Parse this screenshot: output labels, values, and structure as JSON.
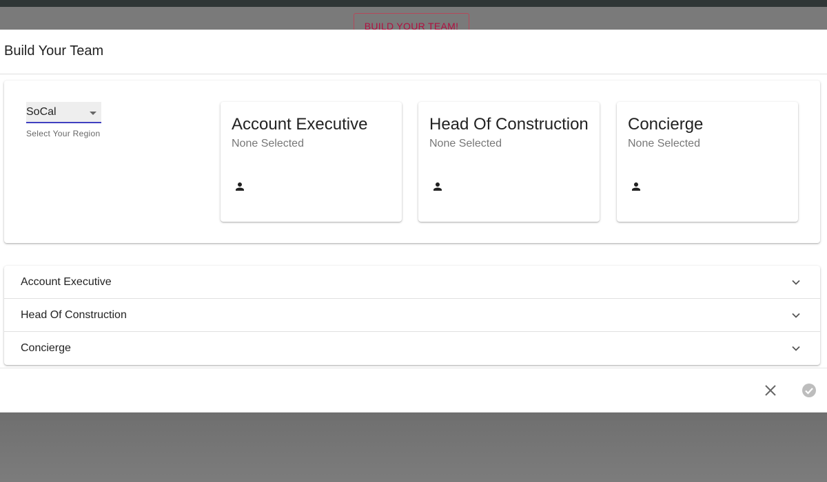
{
  "background": {
    "cta_label": "BUILD YOUR TEAM!"
  },
  "dialog": {
    "title": "Build Your Team",
    "region": {
      "value": "SoCal",
      "helper": "Select Your Region"
    },
    "role_cards": [
      {
        "title": "Account Executive",
        "status": "None Selected",
        "icon": "person-icon"
      },
      {
        "title": "Head Of Construction",
        "status": "None Selected",
        "icon": "person-icon"
      },
      {
        "title": "Concierge",
        "status": "None Selected",
        "icon": "person-icon"
      }
    ],
    "accordion": [
      {
        "label": "Account Executive",
        "icon": "chevron-down-icon"
      },
      {
        "label": "Head Of Construction",
        "icon": "chevron-down-icon"
      },
      {
        "label": "Concierge",
        "icon": "chevron-down-icon"
      }
    ],
    "actions": {
      "close_icon": "close-icon",
      "confirm_icon": "check-circle-icon"
    }
  },
  "colors": {
    "accent_underline": "#3f3fc0",
    "cta_text": "#b01040",
    "overlay": "#7a7a7a"
  }
}
